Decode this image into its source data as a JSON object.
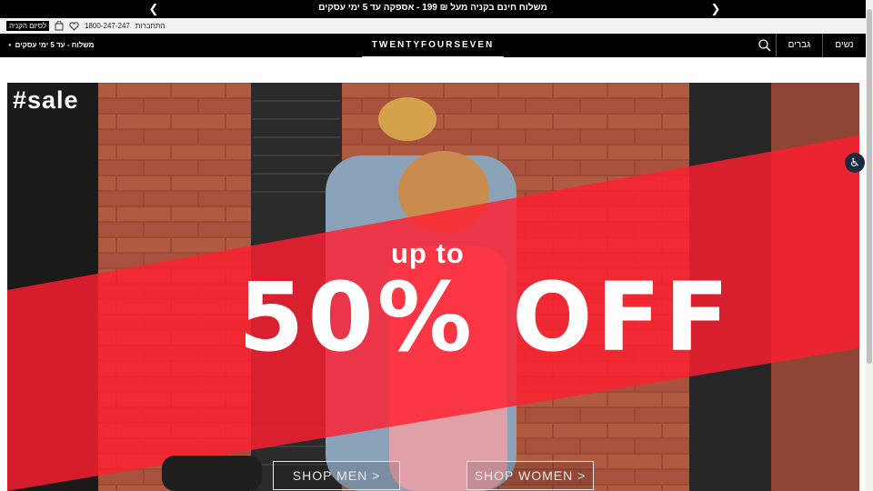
{
  "announcement": {
    "text": "משלוח חינם בקניה מעל ₪ 199  -  אספקה עד 5 ימי עסקים"
  },
  "utility": {
    "cart_label": "לסיום הקניה",
    "phone": "1800-247-247",
    "login": "התחברות"
  },
  "nav": {
    "shipping_note": "משלוח - עד 5 ימי עסקים",
    "logo": "TWENTYFOURSEVEN",
    "tabs": [
      "נשים",
      "גברים"
    ]
  },
  "hero": {
    "hashtag": "#sale",
    "headline": "up to",
    "offer": "50% OFF",
    "buttons": [
      "SHOP MEN >",
      "SHOP WOMEN >"
    ]
  },
  "colors": {
    "banner_red": "#ff2a3a",
    "brick": "#a8503c",
    "bar_black": "#000000"
  },
  "icons": [
    "chevron-left-icon",
    "chevron-right-icon",
    "heart-icon",
    "shopping-bag-icon",
    "search-icon",
    "accessibility-icon"
  ]
}
